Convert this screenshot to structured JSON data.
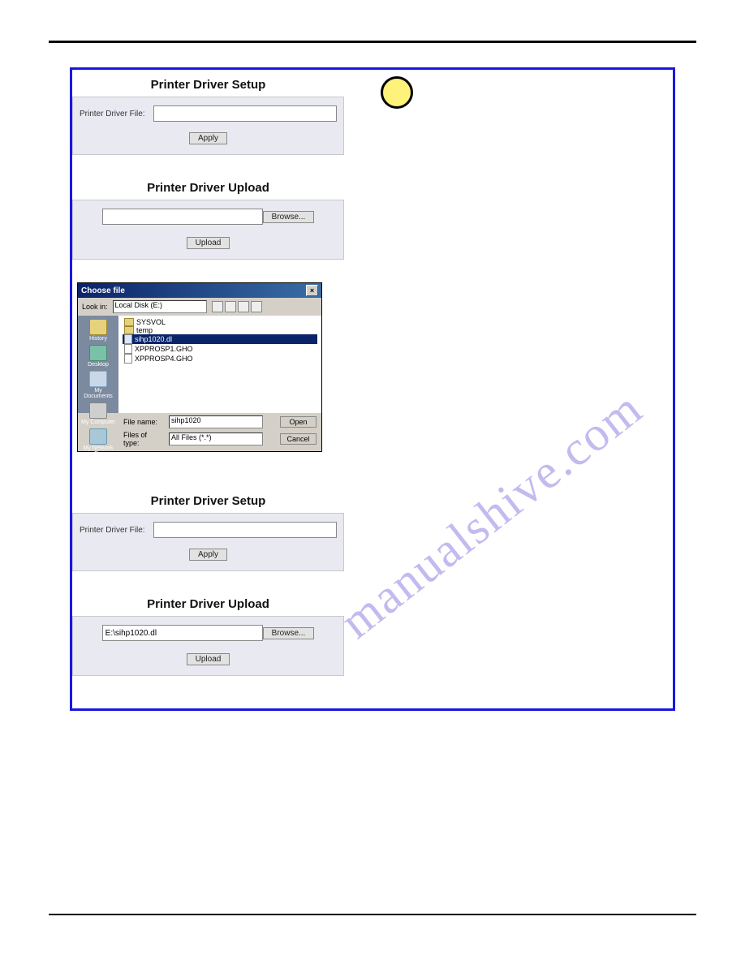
{
  "watermark": "manualshive.com",
  "setup1": {
    "title": "Printer Driver Setup",
    "label": "Printer Driver File:",
    "value": "",
    "apply": "Apply"
  },
  "upload1": {
    "title": "Printer Driver Upload",
    "value": "",
    "browse": "Browse...",
    "upload": "Upload"
  },
  "file_dialog": {
    "title": "Choose file",
    "lookin_label": "Look in:",
    "lookin_value": "Local Disk (E:)",
    "sidebar": {
      "history": "History",
      "desktop": "Desktop",
      "documents": "My Documents",
      "computer": "My Computer",
      "network": "My Network P..."
    },
    "files": {
      "f0": "SYSVOL",
      "f1": "temp",
      "f2": "sihp1020.dl",
      "f3": "XPPROSP1.GHO",
      "f4": "XPPROSP4.GHO"
    },
    "filename_label": "File name:",
    "filename_value": "sihp1020",
    "filetype_label": "Files of type:",
    "filetype_value": "All Files (*.*)",
    "open": "Open",
    "cancel": "Cancel"
  },
  "setup2": {
    "title": "Printer Driver Setup",
    "label": "Printer Driver File:",
    "value": "",
    "apply": "Apply"
  },
  "upload2": {
    "title": "Printer Driver Upload",
    "value": "E:\\sihp1020.dl",
    "browse": "Browse...",
    "upload": "Upload"
  }
}
